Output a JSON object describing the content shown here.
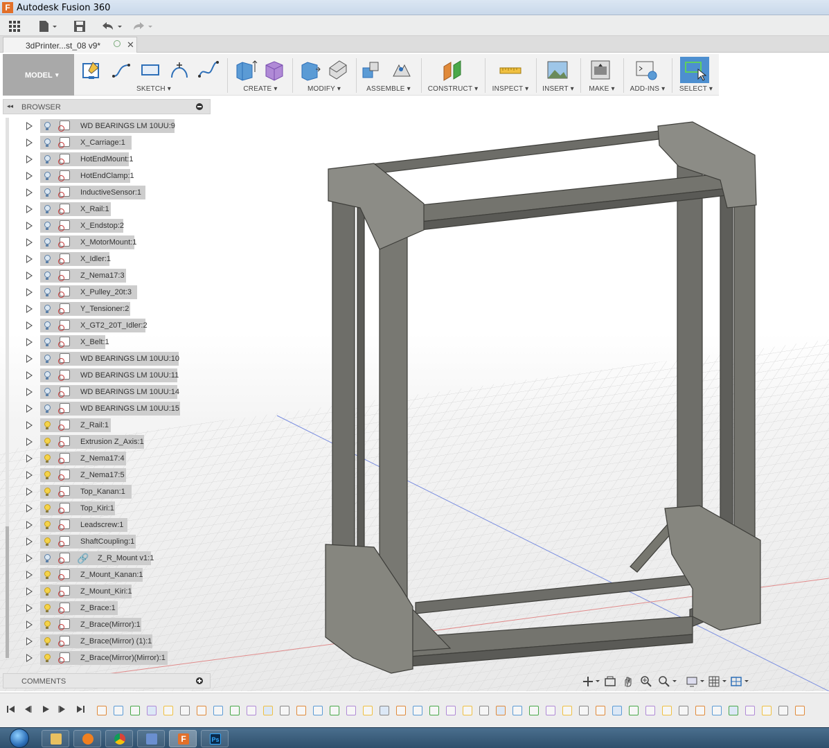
{
  "window": {
    "title": "Autodesk Fusion 360",
    "logo_letter": "F"
  },
  "quick_access": {
    "grid_icon": "grid-icon",
    "file_icon": "file-icon",
    "save_icon": "save-icon",
    "undo_icon": "undo-icon",
    "redo_icon": "redo-icon"
  },
  "document_tab": {
    "label": "3dPrinter...st_08 v9*",
    "close": "✕"
  },
  "toolbar": {
    "workspace": "MODEL",
    "groups": [
      {
        "label": "SKETCH"
      },
      {
        "label": "CREATE"
      },
      {
        "label": "MODIFY"
      },
      {
        "label": "ASSEMBLE"
      },
      {
        "label": "CONSTRUCT"
      },
      {
        "label": "INSPECT"
      },
      {
        "label": "INSERT"
      },
      {
        "label": "MAKE"
      },
      {
        "label": "ADD-INS"
      },
      {
        "label": "SELECT"
      }
    ],
    "dropdown_caret": "▾"
  },
  "browser": {
    "title": "BROWSER",
    "collapse_glyph": "◂◂",
    "items": [
      {
        "label": "WD BEARINGS LM 10UU:9",
        "light": "off"
      },
      {
        "label": "X_Carriage:1",
        "light": "off"
      },
      {
        "label": "HotEndMount:1",
        "light": "off"
      },
      {
        "label": "HotEndClamp:1",
        "light": "off"
      },
      {
        "label": "InductiveSensor:1",
        "light": "off"
      },
      {
        "label": "X_Rail:1",
        "light": "off"
      },
      {
        "label": "X_Endstop:2",
        "light": "off"
      },
      {
        "label": "X_MotorMount:1",
        "light": "off"
      },
      {
        "label": "X_Idler:1",
        "light": "off"
      },
      {
        "label": "Z_Nema17:3",
        "light": "off"
      },
      {
        "label": "X_Pulley_20t:3",
        "light": "off"
      },
      {
        "label": "Y_Tensioner:2",
        "light": "off"
      },
      {
        "label": "X_GT2_20T_Idler:2",
        "light": "off"
      },
      {
        "label": "X_Belt:1",
        "light": "off"
      },
      {
        "label": "WD BEARINGS LM 10UU:10",
        "light": "off"
      },
      {
        "label": "WD BEARINGS LM 10UU:11",
        "light": "off"
      },
      {
        "label": "WD BEARINGS LM 10UU:14",
        "light": "off"
      },
      {
        "label": "WD BEARINGS LM 10UU:15",
        "light": "off"
      },
      {
        "label": "Z_Rail:1",
        "light": "on"
      },
      {
        "label": "Extrusion Z_Axis:1",
        "light": "on"
      },
      {
        "label": "Z_Nema17:4",
        "light": "on"
      },
      {
        "label": "Z_Nema17:5",
        "light": "on"
      },
      {
        "label": "Top_Kanan:1",
        "light": "on"
      },
      {
        "label": "Top_Kiri:1",
        "light": "on"
      },
      {
        "label": "Leadscrew:1",
        "light": "on"
      },
      {
        "label": "ShaftCoupling:1",
        "light": "on"
      },
      {
        "label": "Z_R_Mount v1:1",
        "light": "off",
        "linked": true
      },
      {
        "label": "Z_Mount_Kanan:1",
        "light": "on"
      },
      {
        "label": "Z_Mount_Kiri:1",
        "light": "on"
      },
      {
        "label": "Z_Brace:1",
        "light": "on"
      },
      {
        "label": "Z_Brace(Mirror):1",
        "light": "on"
      },
      {
        "label": "Z_Brace(Mirror) (1):1",
        "light": "on"
      },
      {
        "label": "Z_Brace(Mirror)(Mirror):1",
        "light": "on"
      }
    ]
  },
  "comments": {
    "title": "COMMENTS"
  },
  "taskbar": {
    "apps": [
      "explorer",
      "media-player",
      "chrome",
      "network",
      "fusion-360",
      "photoshop"
    ],
    "ps_label": "Ps",
    "f_label": "F"
  }
}
